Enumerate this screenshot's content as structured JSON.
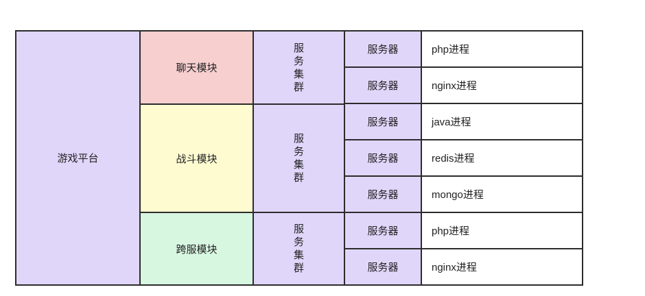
{
  "platform": "游戏平台",
  "modules": [
    {
      "label": "聊天模块",
      "cluster": [
        "服",
        "务",
        "集",
        "群"
      ]
    },
    {
      "label": "战斗模块",
      "cluster": [
        "服",
        "务",
        "集",
        "群"
      ]
    },
    {
      "label": "跨服模块",
      "cluster": [
        "服",
        "务",
        "集",
        "群"
      ]
    }
  ],
  "rows": [
    {
      "server": "服务器",
      "process": "php进程"
    },
    {
      "server": "服务器",
      "process": "nginx进程"
    },
    {
      "server": "服务器",
      "process": "java进程"
    },
    {
      "server": "服务器",
      "process": "redis进程"
    },
    {
      "server": "服务器",
      "process": "mongo进程"
    },
    {
      "server": "服务器",
      "process": "php进程"
    },
    {
      "server": "服务器",
      "process": "nginx进程"
    }
  ],
  "colors": {
    "platform": "#e0d6fa",
    "chat": "#f7cfcf",
    "battle": "#fefbd1",
    "cross": "#d8f7e1",
    "cluster": "#e0d6fa",
    "server": "#e0d6fa",
    "process": "#ffffff"
  }
}
